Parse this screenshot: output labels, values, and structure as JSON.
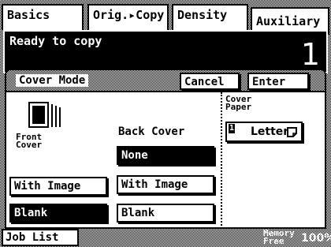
{
  "tabs": [
    {
      "label": "Basics",
      "active": false
    },
    {
      "label": "Orig.▸Copy",
      "active": false
    },
    {
      "label": "Density",
      "active": false
    },
    {
      "label": "Auxiliary",
      "active": true
    }
  ],
  "status": {
    "message": "Ready to copy",
    "copy_count": "1"
  },
  "mode": {
    "title": "Cover Mode",
    "cancel_label": "Cancel",
    "enter_label": "Enter"
  },
  "front_cover": {
    "label_line1": "Front",
    "label_line2": "Cover",
    "options": [
      {
        "label": "With Image",
        "selected": false
      },
      {
        "label": "Blank",
        "selected": true
      }
    ]
  },
  "back_cover": {
    "label": "Back Cover",
    "options": [
      {
        "label": "None",
        "selected": true
      },
      {
        "label": "With Image",
        "selected": false
      },
      {
        "label": "Blank",
        "selected": false
      }
    ]
  },
  "cover_paper": {
    "label_line1": "Cover",
    "label_line2": "Paper",
    "tray_number": "1",
    "paper_size": "Letter"
  },
  "footer": {
    "job_list_label": "Job List",
    "memory_line1": "Memory",
    "memory_line2": "Free",
    "memory_value": "100%"
  }
}
